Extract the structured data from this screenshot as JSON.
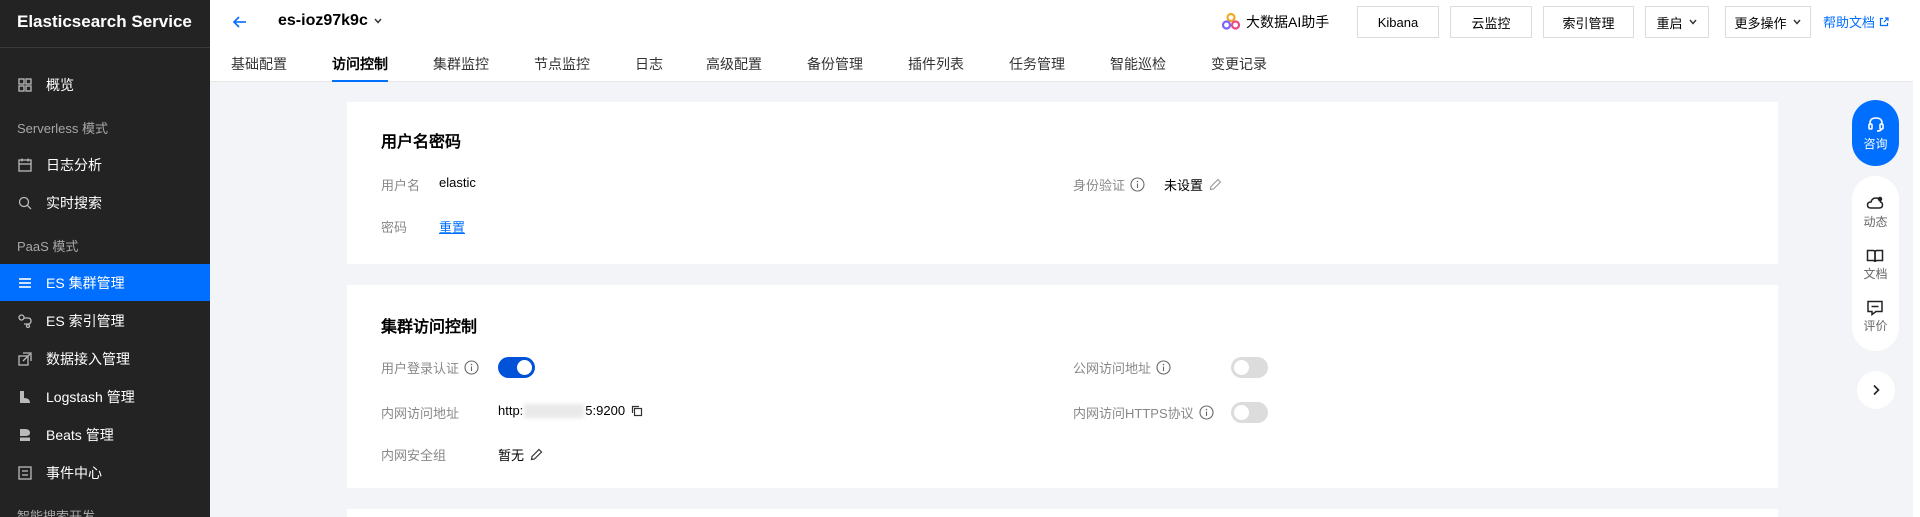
{
  "sidebar": {
    "title": "Elasticsearch Service",
    "items": [
      {
        "label": "概览",
        "icon": "grid-icon"
      },
      {
        "label": "日志分析",
        "icon": "calendar-icon"
      },
      {
        "label": "实时搜索",
        "icon": "search-doc-icon"
      },
      {
        "label": "ES 集群管理",
        "icon": "list-icon",
        "active": true
      },
      {
        "label": "ES 索引管理",
        "icon": "index-icon"
      },
      {
        "label": "数据接入管理",
        "icon": "data-import-icon"
      },
      {
        "label": "Logstash 管理",
        "icon": "logstash-icon"
      },
      {
        "label": "Beats 管理",
        "icon": "beats-icon"
      },
      {
        "label": "事件中心",
        "icon": "event-icon"
      }
    ],
    "groups": [
      "Serverless 模式",
      "PaaS 模式",
      "智能搜索开发"
    ]
  },
  "header": {
    "instance_name": "es-ioz97k9c",
    "ai_assistant": "大数据AI助手",
    "buttons": [
      "Kibana",
      "云监控",
      "索引管理",
      "重启",
      "更多操作"
    ],
    "help": "帮助文档",
    "tabs": [
      "基础配置",
      "访问控制",
      "集群监控",
      "节点监控",
      "日志",
      "高级配置",
      "备份管理",
      "插件列表",
      "任务管理",
      "智能巡检",
      "变更记录"
    ],
    "active_tab": "访问控制"
  },
  "user_card": {
    "title": "用户名密码",
    "username_label": "用户名",
    "username_value": "elastic",
    "password_label": "密码",
    "password_action": "重置",
    "auth_label": "身份验证",
    "auth_value": "未设置"
  },
  "access_card": {
    "title": "集群访问控制",
    "login_auth_label": "用户登录认证",
    "login_auth_on": true,
    "internal_addr_label": "内网访问地址",
    "internal_addr_prefix": "http:",
    "internal_addr_suffix": "5:9200",
    "internal_sg_label": "内网安全组",
    "internal_sg_value": "暂无",
    "public_addr_label": "公网访问地址",
    "public_addr_on": false,
    "internal_https_label": "内网访问HTTPS协议",
    "internal_https_on": false
  },
  "float": {
    "consult": "咨询",
    "items": [
      "动态",
      "文档",
      "评价"
    ]
  },
  "colors": {
    "primary": "#006eff",
    "toggle_on": "#0052d9",
    "sidebar_bg": "#232323"
  }
}
